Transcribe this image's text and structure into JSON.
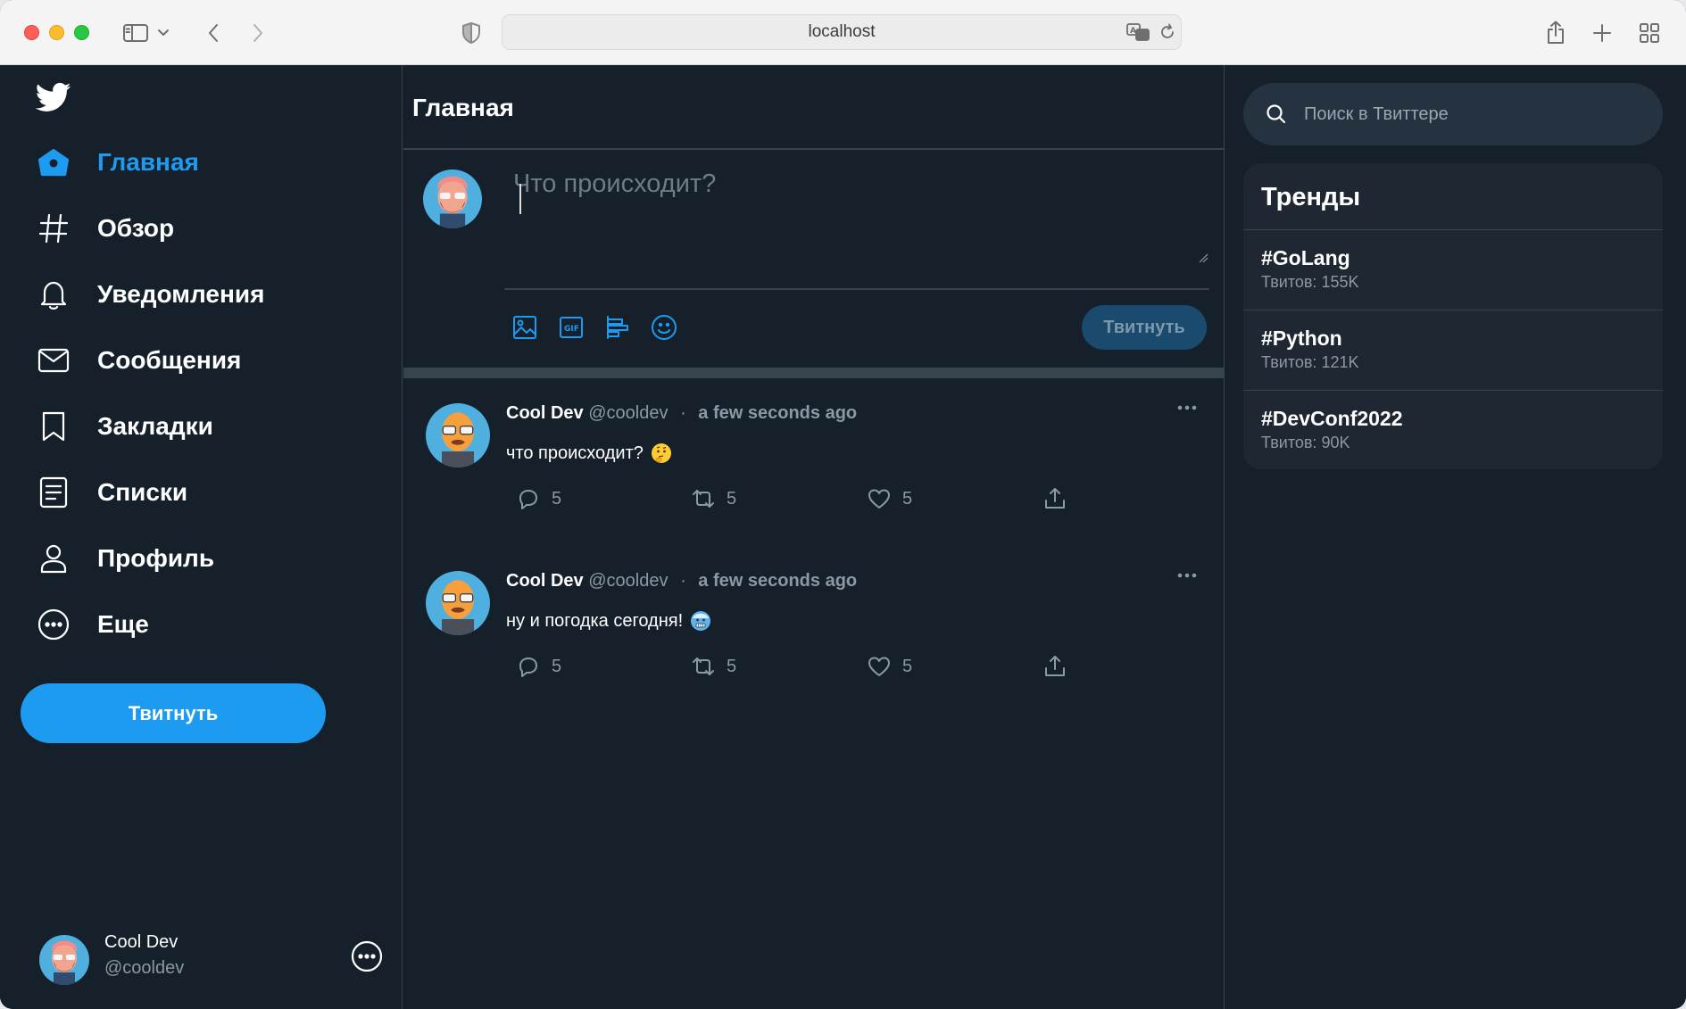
{
  "browser": {
    "url": "localhost"
  },
  "sidebar": {
    "items": [
      {
        "label": "Главная",
        "icon": "home-icon",
        "active": true
      },
      {
        "label": "Обзор",
        "icon": "hashtag-icon",
        "active": false
      },
      {
        "label": "Уведомления",
        "icon": "bell-icon",
        "active": false
      },
      {
        "label": "Сообщения",
        "icon": "mail-icon",
        "active": false
      },
      {
        "label": "Закладки",
        "icon": "bookmark-icon",
        "active": false
      },
      {
        "label": "Списки",
        "icon": "list-icon",
        "active": false
      },
      {
        "label": "Профиль",
        "icon": "profile-icon",
        "active": false
      },
      {
        "label": "Еще",
        "icon": "more-circle-icon",
        "active": false
      }
    ],
    "tweet_button": "Твитнуть",
    "user": {
      "name": "Cool Dev",
      "handle": "@cooldev"
    }
  },
  "feed": {
    "title": "Главная",
    "composer": {
      "placeholder": "Что происходит?",
      "submit_label": "Твитнуть"
    },
    "tweets": [
      {
        "name": "Cool Dev",
        "handle": "@cooldev",
        "dot": "·",
        "time": "a few seconds ago",
        "text": "что происходит?",
        "emoji": "thinking-face-emoji",
        "replies": "5",
        "retweets": "5",
        "likes": "5"
      },
      {
        "name": "Cool Dev",
        "handle": "@cooldev",
        "dot": "·",
        "time": "a few seconds ago",
        "text": "ну и погодка сегодня!",
        "emoji": "cold-face-emoji",
        "replies": "5",
        "retweets": "5",
        "likes": "5"
      }
    ]
  },
  "right": {
    "search_placeholder": "Поиск в Твиттере",
    "trends_title": "Тренды",
    "trends": [
      {
        "tag": "#GoLang",
        "count": "Твитов: 155K"
      },
      {
        "tag": "#Python",
        "count": "Твитов: 121K"
      },
      {
        "tag": "#DevConf2022",
        "count": "Твитов: 90K"
      }
    ]
  },
  "colors": {
    "background": "#15202b",
    "accent": "#1d9bf0",
    "border": "#38444d",
    "muted": "#8b98a5",
    "card": "#1e2732"
  }
}
